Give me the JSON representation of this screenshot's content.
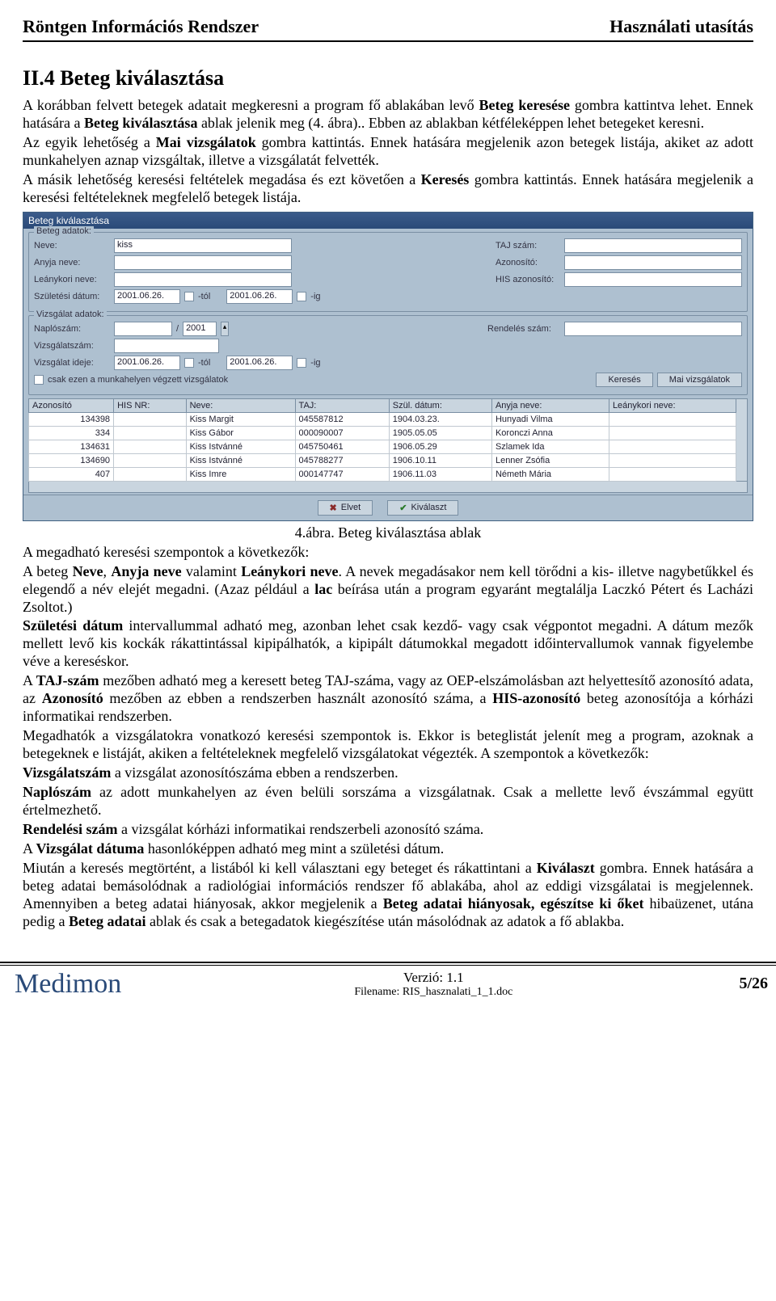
{
  "header": {
    "left": "Röntgen Információs Rendszer",
    "right": "Használati utasítás"
  },
  "section_title": "II.4 Beteg kiválasztása",
  "intro_p1a": "A korábban felvett betegek adatait megkeresni a program fő ablakában levő ",
  "intro_p1b": "Beteg keresése",
  "intro_p1c": " gombra kattintva lehet. Ennek hatására a ",
  "intro_p1d": "Beteg kiválasztása",
  "intro_p1e": " ablak jelenik meg (4. ábra).. Ebben az ablakban kétféleképpen lehet betegeket keresni.",
  "intro_p2a": "Az egyik lehetőség a ",
  "intro_p2b": "Mai vizsgálatok",
  "intro_p2c": " gombra kattintás. Ennek hatására megjelenik azon betegek listája, akiket az adott munkahelyen aznap vizsgáltak, illetve a vizsgálatát felvették.",
  "intro_p3a": "A másik lehetőség keresési feltételek megadása és ezt követően a ",
  "intro_p3b": "Keresés",
  "intro_p3c": " gombra kattintás. Ennek hatására megjelenik a keresési feltételeknek megfelelő betegek listája.",
  "win": {
    "title": "Beteg kiválasztása",
    "group_beteg": "Beteg adatok:",
    "group_vizsg": "Vizsgálat adatok:",
    "lbl_neve": "Neve:",
    "val_neve": "kiss",
    "lbl_taj": "TAJ szám:",
    "lbl_anyja": "Anyja neve:",
    "lbl_azon": "Azonosító:",
    "lbl_leany": "Leánykori neve:",
    "lbl_his": "HIS azonosító:",
    "lbl_szuld": "Születési dátum:",
    "lbl_tol": "-tól",
    "lbl_ig": "-ig",
    "date1": "2001.06.26.",
    "date2": "2001.06.26.",
    "lbl_naplo": "Naplószám:",
    "lbl_slash": "/",
    "val_ev": "2001",
    "lbl_rend": "Rendelés szám:",
    "lbl_vszam": "Vizsgálatszám:",
    "lbl_videje": "Vizsgálat ideje:",
    "chk_local": "csak ezen a munkahelyen végzett vizsgálatok",
    "btn_kereses": "Keresés",
    "btn_mai": "Mai vizsgálatok",
    "btn_elvet": "Elvet",
    "btn_kivalaszt": "Kiválaszt",
    "cols": [
      "Azonosító",
      "HIS NR:",
      "Neve:",
      "TAJ:",
      "Szül. dátum:",
      "Anyja neve:",
      "Leánykori neve:"
    ],
    "rows": [
      [
        "134398",
        "",
        "Kiss Margit",
        "045587812",
        "1904.03.23.",
        "Hunyadi Vilma",
        ""
      ],
      [
        "334",
        "",
        "Kiss Gábor",
        "000090007",
        "1905.05.05",
        "Koronczi Anna",
        ""
      ],
      [
        "134631",
        "",
        "Kiss Istvánné",
        "045750461",
        "1906.05.29",
        "Szlamek Ida",
        ""
      ],
      [
        "134690",
        "",
        "Kiss Istvánné",
        "045788277",
        "1906.10.11",
        "Lenner Zsófia",
        ""
      ],
      [
        "407",
        "",
        "Kiss Imre",
        "000147747",
        "1906.11.03",
        "Németh Mária",
        ""
      ]
    ]
  },
  "caption": "4.ábra. Beteg kiválasztása ablak",
  "body": {
    "p1": "A megadható keresési szempontok a következők:",
    "p2a": "A beteg ",
    "p2b": "Neve",
    "p2c": ", ",
    "p2d": "Anyja neve",
    "p2e": " valamint ",
    "p2f": "Leánykori neve",
    "p2g": ". A nevek megadásakor nem kell törődni a kis- illetve nagybetűkkel és elegendő a név elejét megadni. (Azaz például a ",
    "p2h": "lac",
    "p2i": " beírása után a program egyaránt megtalálja Laczkó Pétert és Lacházi Zsoltot.)",
    "p3a": "Születési dátum",
    "p3b": " intervallummal adható meg, azonban lehet csak kezdő- vagy csak végpontot megadni. A dátum mezők mellett levő kis kockák rákattintással kipipálhatók, a kipipált dátumokkal megadott időintervallumok vannak figyelembe véve a kereséskor.",
    "p4a": "A ",
    "p4b": "TAJ-szám",
    "p4c": " mezőben adható meg a keresett beteg TAJ-száma, vagy az OEP-elszámolásban azt helyettesítő azonosító adata, az ",
    "p4d": "Azonosító",
    "p4e": " mezőben az ebben a rendszerben használt azonosító száma, a ",
    "p4f": "HIS-azonosító",
    "p4g": " beteg azonosítója a kórházi informatikai rendszerben.",
    "p5": "Megadhatók a vizsgálatokra vonatkozó keresési szempontok is. Ekkor is beteglistát jelenít meg a program, azoknak a betegeknek e listáját, akiken a feltételeknek megfelelő vizsgálatokat végezték. A szempontok a következők:",
    "p6a": "Vizsgálatszám",
    "p6b": " a vizsgálat azonosítószáma ebben a rendszerben.",
    "p7a": "Naplószám",
    "p7b": " az adott munkahelyen az éven belüli sorszáma a vizsgálatnak. Csak a mellette levő évszámmal együtt értelmezhető.",
    "p8a": "Rendelési szám",
    "p8b": " a vizsgálat kórházi informatikai rendszerbeli azonosító száma.",
    "p9a": "A ",
    "p9b": "Vizsgálat dátuma",
    "p9c": " hasonlóképpen adható meg mint a születési dátum.",
    "p10a": "Miután a keresés megtörtént, a listából ki kell választani egy beteget és rákattintani a ",
    "p10b": "Kiválaszt",
    "p10c": " gombra. Ennek hatására a beteg adatai bemásolódnak a radiológiai információs rendszer fő ablakába, ahol az eddigi vizsgálatai is megjelennek. Amennyiben a beteg adatai hiányosak, akkor megjelenik a ",
    "p10d": "Beteg adatai hiányosak, egészítse ki őket",
    "p10e": " hibaüzenet, utána pedig a ",
    "p10f": "Beteg adatai",
    "p10g": " ablak és csak a betegadatok kiegészítése után másolódnak az adatok a fő ablakba."
  },
  "footer": {
    "logo": "Medimon",
    "ver": "Verzió: 1.1",
    "file": "Filename: RIS_hasznalati_1_1.doc",
    "page": "5/26"
  }
}
